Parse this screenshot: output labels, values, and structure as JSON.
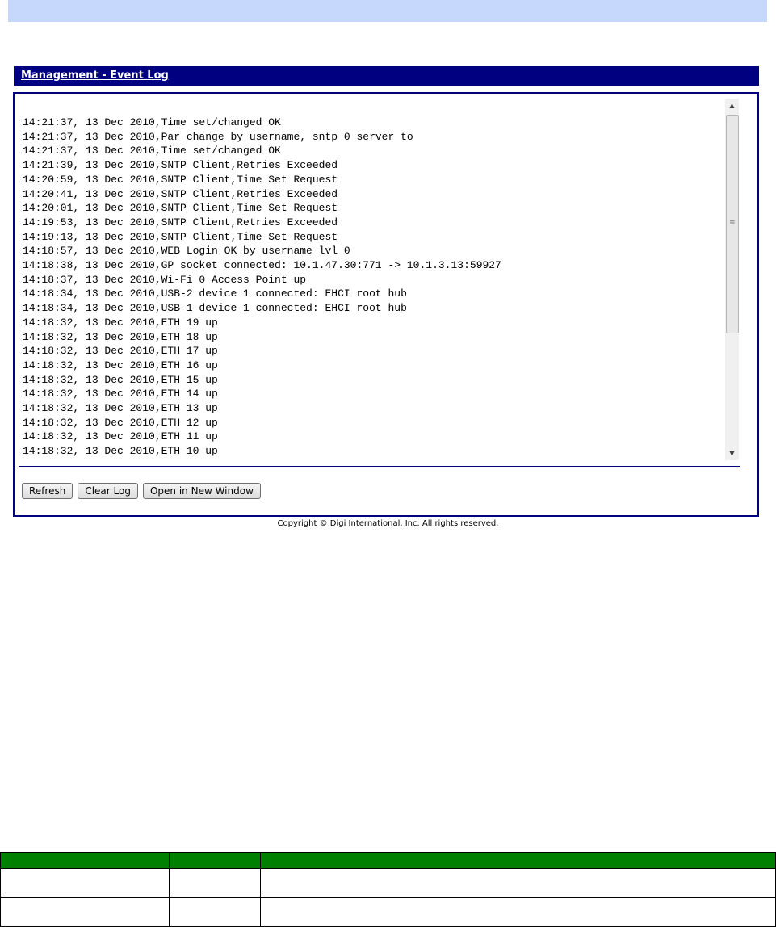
{
  "header": {
    "title": "Management - Event Log"
  },
  "event_log": {
    "lines": [
      "14:21:37, 13 Dec 2010,Time set/changed OK",
      "14:21:37, 13 Dec 2010,Par change by username, sntp 0 server to",
      "14:21:37, 13 Dec 2010,Time set/changed OK",
      "14:21:39, 13 Dec 2010,SNTP Client,Retries Exceeded",
      "14:20:59, 13 Dec 2010,SNTP Client,Time Set Request",
      "14:20:41, 13 Dec 2010,SNTP Client,Retries Exceeded",
      "14:20:01, 13 Dec 2010,SNTP Client,Time Set Request",
      "14:19:53, 13 Dec 2010,SNTP Client,Retries Exceeded",
      "14:19:13, 13 Dec 2010,SNTP Client,Time Set Request",
      "14:18:57, 13 Dec 2010,WEB Login OK by username lvl 0",
      "14:18:38, 13 Dec 2010,GP socket connected: 10.1.47.30:771 -> 10.1.3.13:59927",
      "14:18:37, 13 Dec 2010,Wi-Fi 0 Access Point up",
      "14:18:34, 13 Dec 2010,USB-2 device 1 connected: EHCI root hub",
      "14:18:34, 13 Dec 2010,USB-1 device 1 connected: EHCI root hub",
      "14:18:32, 13 Dec 2010,ETH 19 up",
      "14:18:32, 13 Dec 2010,ETH 18 up",
      "14:18:32, 13 Dec 2010,ETH 17 up",
      "14:18:32, 13 Dec 2010,ETH 16 up",
      "14:18:32, 13 Dec 2010,ETH 15 up",
      "14:18:32, 13 Dec 2010,ETH 14 up",
      "14:18:32, 13 Dec 2010,ETH 13 up",
      "14:18:32, 13 Dec 2010,ETH 12 up",
      "14:18:32, 13 Dec 2010,ETH 11 up",
      "14:18:32, 13 Dec 2010,ETH 10 up"
    ],
    "scrollbar": {
      "up_icon": "▲",
      "down_icon": "▼",
      "grip_icon": "≡"
    }
  },
  "buttons": {
    "refresh": "Refresh",
    "clear_log": "Clear Log",
    "open_new_window": "Open in New Window"
  },
  "footer": {
    "copyright": "Copyright © Digi International, Inc. All rights reserved."
  },
  "colors": {
    "title_bar": "#000080",
    "top_band": "#c6d9fd",
    "table_header": "#008000"
  }
}
